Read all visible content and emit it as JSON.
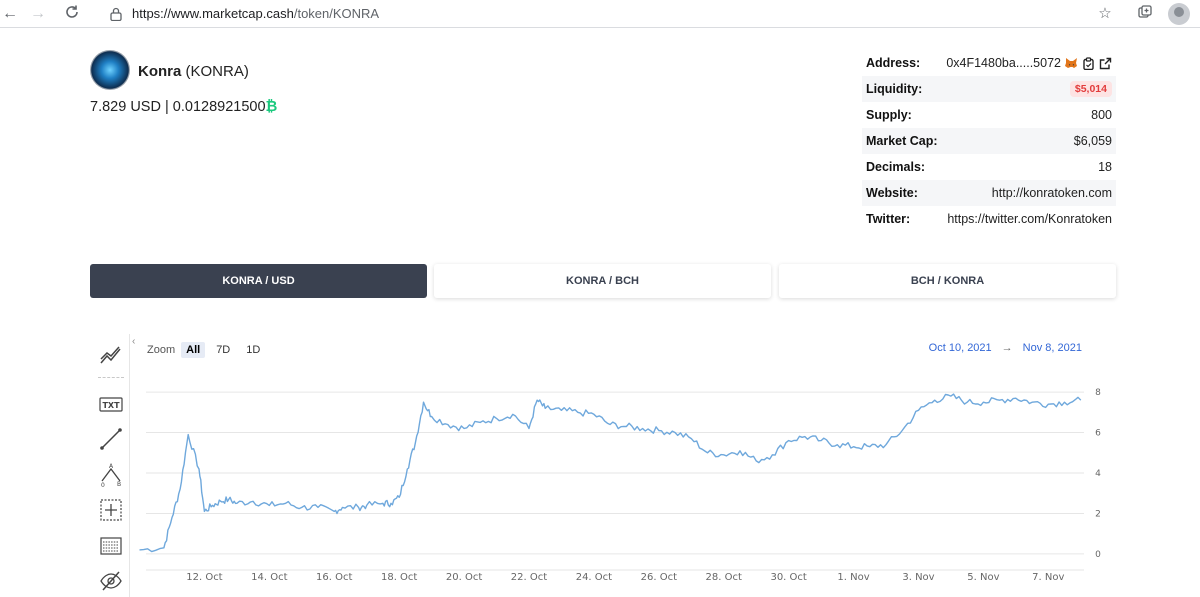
{
  "browser": {
    "url_host": "https://www.marketcap.cash",
    "url_path": "/token/KONRA"
  },
  "token": {
    "name": "Konra",
    "symbol": "(KONRA)",
    "price_usd": "7.829 USD",
    "separator": "|",
    "price_bch": "0.0128921500",
    "bch_symbol": "₿"
  },
  "info": {
    "address_label": "Address:",
    "address_value": "0x4F1480ba.....5072",
    "liquidity_label": "Liquidity:",
    "liquidity_value": "$5,014",
    "supply_label": "Supply:",
    "supply_value": "800",
    "marketcap_label": "Market Cap:",
    "marketcap_value": "$6,059",
    "decimals_label": "Decimals:",
    "decimals_value": "18",
    "website_label": "Website:",
    "website_value": "http://konratoken.com",
    "twitter_label": "Twitter:",
    "twitter_value": "https://twitter.com/Konratoken"
  },
  "tabs": [
    {
      "label": "KONRA / USD",
      "active": true
    },
    {
      "label": "KONRA / BCH",
      "active": false
    },
    {
      "label": "BCH / KONRA",
      "active": false
    }
  ],
  "chart_controls": {
    "zoom_label": "Zoom",
    "zoom_options": [
      "All",
      "7D",
      "1D"
    ],
    "range_from": "Oct 10, 2021",
    "range_arrow": "→",
    "range_to": "Nov 8, 2021"
  },
  "toolbar_icons": [
    "trend-lines-icon",
    "text-icon",
    "line-icon",
    "abc-pattern-icon",
    "measure-icon",
    "ruler-icon",
    "hide-icon"
  ],
  "colors": {
    "line": "#6fa8dc",
    "active_tab": "#3a4150",
    "liquidity_red": "#e23c3c",
    "bch_green": "#1bc97e"
  },
  "chart_data": {
    "type": "line",
    "xlabel": "",
    "ylabel": "",
    "x_ticks": [
      "12. Oct",
      "14. Oct",
      "16. Oct",
      "18. Oct",
      "20. Oct",
      "22. Oct",
      "24. Oct",
      "26. Oct",
      "28. Oct",
      "30. Oct",
      "1. Nov",
      "3. Nov",
      "5. Nov",
      "7. Nov"
    ],
    "x_range": [
      "2021-10-10",
      "2021-11-08"
    ],
    "y_ticks": [
      0,
      2,
      4,
      6,
      8
    ],
    "ylim": [
      -0.4,
      8.4
    ],
    "grid": true,
    "series": [
      {
        "x": [
          "2021-10-10",
          "2021-10-10T18:00",
          "2021-10-11",
          "2021-10-11T06:00",
          "2021-10-11T12:00",
          "2021-10-11T20:00",
          "2021-10-12",
          "2021-10-12T06:00",
          "2021-10-12T12:00",
          "2021-10-12T18:00",
          "2021-10-13",
          "2021-10-13T12:00",
          "2021-10-14",
          "2021-10-14T12:00",
          "2021-10-15",
          "2021-10-15T12:00",
          "2021-10-16",
          "2021-10-16T06:00",
          "2021-10-16T18:00",
          "2021-10-17",
          "2021-10-17T12:00",
          "2021-10-17T18:00",
          "2021-10-18",
          "2021-10-18T06:00",
          "2021-10-18T12:00",
          "2021-10-18T18:00",
          "2021-10-19",
          "2021-10-19T12:00",
          "2021-10-20",
          "2021-10-20T12:00",
          "2021-10-21",
          "2021-10-21T12:00",
          "2021-10-22",
          "2021-10-22T06:00",
          "2021-10-22T12:00",
          "2021-10-23",
          "2021-10-23T12:00",
          "2021-10-24",
          "2021-10-24T12:00",
          "2021-10-25",
          "2021-10-25T12:00",
          "2021-10-26",
          "2021-10-26T12:00",
          "2021-10-27",
          "2021-10-27T12:00",
          "2021-10-28",
          "2021-10-28T12:00",
          "2021-10-29",
          "2021-10-29T12:00",
          "2021-10-30",
          "2021-10-30T12:00",
          "2021-10-31",
          "2021-10-31T12:00",
          "2021-11-01",
          "2021-11-01T12:00",
          "2021-11-02",
          "2021-11-02T12:00",
          "2021-11-03",
          "2021-11-03T12:00",
          "2021-11-04",
          "2021-11-04T12:00",
          "2021-11-05",
          "2021-11-05T12:00",
          "2021-11-06",
          "2021-11-06T12:00",
          "2021-11-07",
          "2021-11-07T12:00",
          "2021-11-08"
        ],
        "values": [
          0.2,
          0.3,
          1.8,
          3.2,
          5.9,
          4.2,
          2.1,
          2.4,
          2.6,
          2.7,
          2.5,
          2.6,
          2.4,
          2.5,
          2.3,
          2.3,
          2.1,
          2.3,
          2.3,
          2.4,
          2.5,
          2.5,
          2.8,
          4.2,
          5.5,
          7.5,
          6.8,
          6.4,
          6.2,
          6.5,
          6.7,
          6.9,
          6.2,
          7.6,
          7.2,
          7.1,
          7.0,
          6.9,
          6.4,
          6.3,
          6.2,
          6.1,
          6.0,
          5.7,
          5.0,
          4.9,
          5.1,
          4.6,
          4.9,
          5.6,
          5.8,
          5.6,
          5.4,
          5.3,
          5.3,
          5.4,
          6.1,
          7.1,
          7.6,
          7.8,
          7.5,
          7.5,
          7.6,
          7.7,
          7.5,
          7.4,
          7.5,
          7.6
        ]
      }
    ]
  }
}
